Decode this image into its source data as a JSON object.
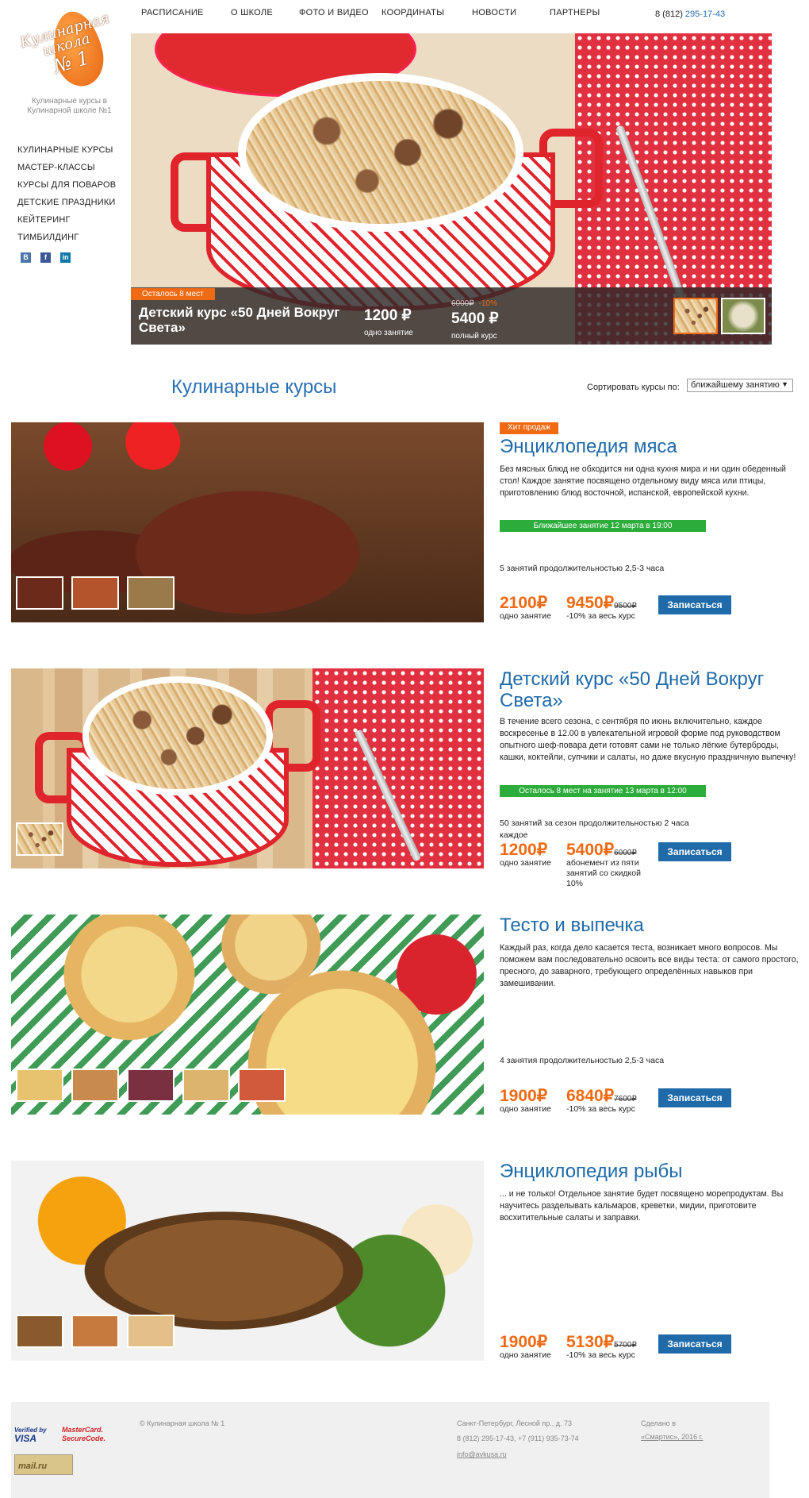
{
  "logo": {
    "line1": "Кулинарная",
    "line2": "школа",
    "line3": "№ 1"
  },
  "school_sub": "Кулинарные курсы в Кулинарной школе №1",
  "side_menu": [
    "КУЛИНАРНЫЕ КУРСЫ",
    "МАСТЕР-КЛАССЫ",
    "КУРСЫ ДЛЯ ПОВАРОВ",
    "ДЕТСКИЕ ПРАЗДНИКИ",
    "КЕЙТЕРИНГ",
    "ТИМБИЛДИНГ"
  ],
  "socials": [
    {
      "icon": "vk-icon",
      "glyph": "В",
      "color": "#4a76a8"
    },
    {
      "icon": "facebook-icon",
      "glyph": "f",
      "color": "#3b5998"
    },
    {
      "icon": "linkedin-icon",
      "glyph": "in",
      "color": "#0e76a8"
    }
  ],
  "top_nav": [
    "РАСПИСАНИЕ",
    "О ШКОЛЕ",
    "ФОТО И ВИДЕО",
    "КООРДИНАТЫ",
    "НОВОСТИ",
    "ПАРТНЕРЫ"
  ],
  "phone": {
    "code": "8 (812)",
    "number": "295-17-43"
  },
  "hero": {
    "badge": "Осталось 8 мест",
    "title": "Детский курс «50 Дней Вокруг Света»",
    "price1": "1200 ₽",
    "price1_label": "одно занятие",
    "old": "6000₽",
    "discount": "-10%",
    "price2": "5400 ₽",
    "price2_label": "полный курс"
  },
  "courses_title": "Кулинарные курсы",
  "sort": {
    "label": "Сортировать курсы по:",
    "value": "ближайшему занятию"
  },
  "courses": [
    {
      "badge": "Хит продаж",
      "title": "Энциклопедия мяса",
      "desc": "Без мясных блюд не обходится ни одна кухня мира и ни один обеденный стол! Каждое занятие посвящено отдельному виду мяса или птицы, приготовлению блюд восточной, испанской, европейской кухни.",
      "next": "Ближайшее занятие 12 марта в 19:00",
      "info": "5 занятий продолжительностью 2,5-3 часа",
      "p1": "2100₽",
      "p1_label": "одно занятие",
      "p2": "9450₽",
      "old": "9500₽",
      "p2_label": "-10% за весь курс",
      "btn": "Записаться"
    },
    {
      "title": "Детский курс «50 Дней Вокруг Света»",
      "desc": "В течение всего сезона, с сентября по июнь включительно, каждое воскресенье в 12.00 в увлекательной игровой форме под руководством опытного шеф-повара дети готовят сами не только лёгкие бутерброды, кашки, коктейли, супчики и салаты, но даже вкусную праздничную выпечку!",
      "next": "Осталось 8 мест на занятие 13 марта в 12:00",
      "info": "50 занятий за сезон продолжительностью 2 часа каждое",
      "p1": "1200₽",
      "p1_label": "одно занятие",
      "p2": "5400₽",
      "old": "6000₽",
      "p2_label": "абонемент из пяти занятий со скидкой 10%",
      "btn": "Записаться"
    },
    {
      "title": "Тесто и выпечка",
      "desc": "Каждый раз, когда дело касается теста, возникает много вопросов. Мы поможем вам последовательно освоить все виды теста: от самого простого, пресного, до заварного, требующего определённых навыков при замешивании.",
      "info": "4 занятия продолжительностью 2,5-3 часа",
      "p1": "1900₽",
      "p1_label": "одно занятие",
      "p2": "6840₽",
      "old": "7600₽",
      "p2_label": "-10% за весь курс",
      "btn": "Записаться"
    },
    {
      "title": "Энциклопедия рыбы",
      "desc": "... и не только! Отдельное занятие будет посвящено морепродуктам. Вы научитесь разделывать кальмаров, креветки, мидии, приготовите восхитительные салаты и заправки.",
      "p1": "1900₽",
      "p1_label": "одно занятие",
      "p2": "5130₽",
      "old": "5700₽",
      "p2_label": "-10% за весь курс",
      "btn": "Записаться"
    }
  ],
  "footer": {
    "verified": "Verified by",
    "visa": "VISA",
    "mc1": "MasterCard.",
    "mc2": "SecureCode.",
    "counter": "mail.ru",
    "copyright": "© Кулинарная школа № 1",
    "address": "Санкт-Петербург, Лесной пр., д. 73",
    "phones": "8 (812) 295-17-43, +7 (911) 935-73-74",
    "email": "info@avkusa.ru",
    "made1": "Сделано в",
    "made2": "«Смартис», 2016 г."
  }
}
